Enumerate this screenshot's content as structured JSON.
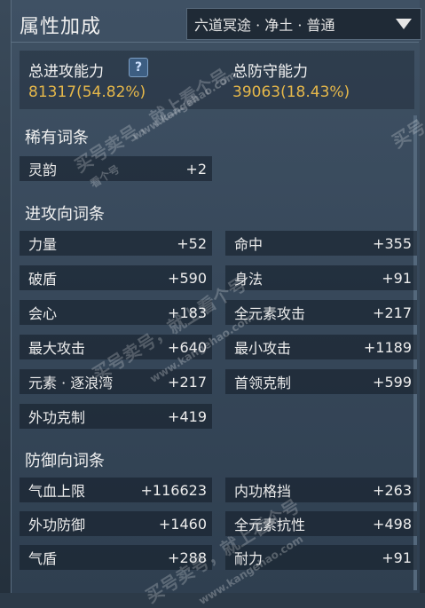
{
  "header": {
    "title": "属性加成",
    "dropdown_value": "六道冥途 · 净土 · 普通"
  },
  "totals": {
    "attack_label": "总进攻能力",
    "attack_value": "81317(54.82%)",
    "defense_label": "总防守能力",
    "defense_value": "39063(18.43%)"
  },
  "sections": {
    "rare": "稀有词条",
    "attack": "进攻向词条",
    "defense": "防御向词条"
  },
  "rare_items": [
    {
      "label": "灵韵",
      "value": "+2"
    }
  ],
  "attack_items": [
    {
      "label": "力量",
      "value": "+52"
    },
    {
      "label": "命中",
      "value": "+355"
    },
    {
      "label": "破盾",
      "value": "+590"
    },
    {
      "label": "身法",
      "value": "+91"
    },
    {
      "label": "会心",
      "value": "+183"
    },
    {
      "label": "全元素攻击",
      "value": "+217"
    },
    {
      "label": "最大攻击",
      "value": "+640"
    },
    {
      "label": "最小攻击",
      "value": "+1189"
    },
    {
      "label": "元素 · 逐浪湾",
      "value": "+217"
    },
    {
      "label": "首领克制",
      "value": "+599"
    },
    {
      "label": "外功克制",
      "value": "+419"
    }
  ],
  "defense_items": [
    {
      "label": "气血上限",
      "value": "+116623"
    },
    {
      "label": "内功格挡",
      "value": "+263"
    },
    {
      "label": "外功防御",
      "value": "+1460"
    },
    {
      "label": "全元素抗性",
      "value": "+498"
    },
    {
      "label": "气盾",
      "value": "+288"
    },
    {
      "label": "耐力",
      "value": "+91"
    }
  ],
  "watermarks": {
    "text": "买号卖号，就上看个号",
    "url": "www.kangehao.com",
    "badge": "看个号",
    "right": "买号"
  },
  "icons": {
    "help": "question-icon",
    "dropdown": "chevron-down-icon"
  }
}
